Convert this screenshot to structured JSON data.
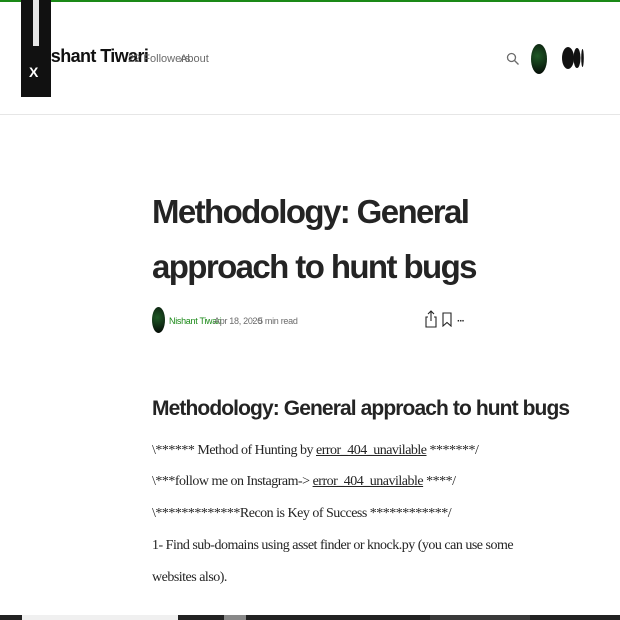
{
  "header": {
    "brand": "Nishant Tiwari",
    "followers": "22 Followers",
    "about": "About",
    "close_label": "X"
  },
  "article": {
    "title": "Methodology: General approach to hunt bugs",
    "author": "Nishant Tiwari",
    "date": "Apr 18, 2020",
    "separator": "·",
    "read_time": "5 min read",
    "more_label": "···",
    "heading": "Methodology: General approach to hunt bugs",
    "p1_prefix": "\\****** Method of Hunting by ",
    "p1_link": "error_404_unavilable",
    "p1_suffix": " *******/",
    "p2_prefix": "\\***follow me on Instagram-> ",
    "p2_link": "error_404_unavilable",
    "p2_suffix": " ****/",
    "p3": "\\*************Recon is Key of Success ************/",
    "p4": "1- Find sub-domains using asset finder or knock.py (you can use some",
    "p5": "websites also)."
  },
  "icons": {
    "search": "search-icon",
    "share": "share-icon",
    "bookmark": "bookmark-icon",
    "more": "more-icon",
    "logo": "medium-logo"
  },
  "colors": {
    "accent": "#1a8917",
    "text": "#242424",
    "muted": "#6b6b6b"
  }
}
